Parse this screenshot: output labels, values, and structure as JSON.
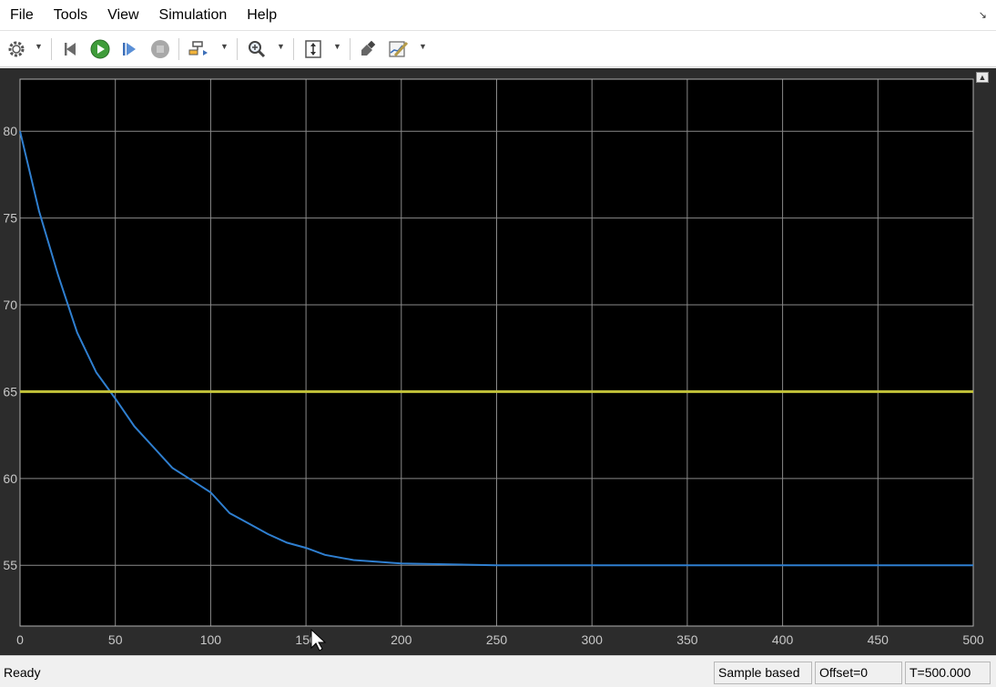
{
  "menu": [
    "File",
    "Tools",
    "View",
    "Simulation",
    "Help"
  ],
  "menu_overflow_icon": "dock-arrow-icon",
  "toolbar": {
    "buttons": [
      {
        "name": "settings-icon"
      },
      {
        "name": "step-back-icon"
      },
      {
        "name": "run-icon"
      },
      {
        "name": "step-forward-icon"
      },
      {
        "name": "stop-icon"
      },
      {
        "name": "highlight-icon"
      },
      {
        "name": "zoom-icon"
      },
      {
        "name": "autoscale-icon"
      },
      {
        "name": "style-icon"
      },
      {
        "name": "measurement-icon"
      }
    ]
  },
  "status": {
    "ready": "Ready",
    "sample": "Sample based",
    "offset": "Offset=0",
    "time": "T=500.000"
  },
  "colors": {
    "plot_bg": "#000000",
    "frame_bg": "#2c2c2c",
    "grid": "#8a8a8a",
    "tick_text": "#c8c8c8",
    "series1": "#2f7fd0",
    "series2": "#c2c23a"
  },
  "chart_data": {
    "type": "line",
    "title": "",
    "xlabel": "",
    "ylabel": "",
    "xlim": [
      0,
      500
    ],
    "ylim": [
      51.5,
      83
    ],
    "xticks": [
      0,
      50,
      100,
      150,
      200,
      250,
      300,
      350,
      400,
      450,
      500
    ],
    "yticks": [
      55,
      60,
      65,
      70,
      75,
      80
    ],
    "grid": true,
    "series": [
      {
        "color": "#2f7fd0",
        "x": [
          0,
          10,
          20,
          30,
          40,
          50,
          60,
          70,
          80,
          90,
          100,
          110,
          120,
          130,
          140,
          150,
          160,
          175,
          200,
          250,
          300,
          350,
          400,
          450,
          500
        ],
        "y": [
          80,
          75.4,
          71.7,
          68.4,
          66.1,
          64.6,
          63.0,
          61.8,
          60.6,
          59.9,
          59.2,
          58.0,
          57.4,
          56.8,
          56.3,
          56.0,
          55.6,
          55.3,
          55.1,
          55.0,
          55.0,
          55.0,
          55.0,
          55.0,
          55.0
        ]
      },
      {
        "color": "#c2c23a",
        "x": [
          0,
          500
        ],
        "y": [
          65,
          65
        ]
      }
    ]
  }
}
